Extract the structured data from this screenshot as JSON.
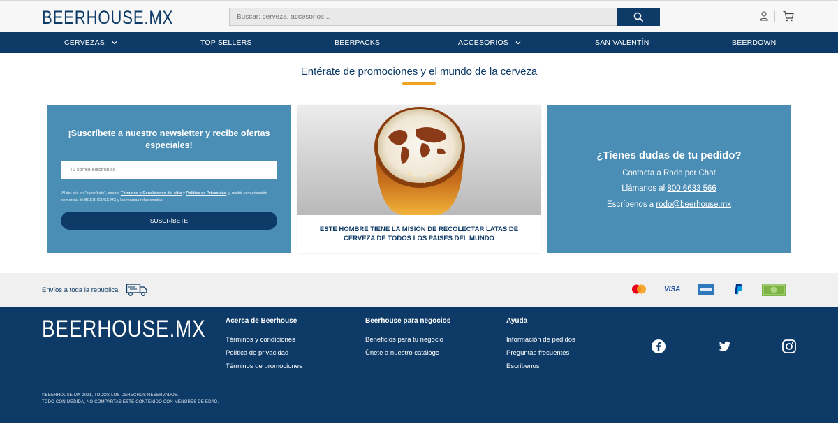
{
  "header": {
    "logo": "BEERHOUSE.MX",
    "search_placeholder": "Buscar: cerveza, accesorios..."
  },
  "nav": {
    "items": [
      {
        "label": "CERVEZAS",
        "has_dropdown": true
      },
      {
        "label": "TOP SELLERS",
        "has_dropdown": false
      },
      {
        "label": "BEERPACKS",
        "has_dropdown": false
      },
      {
        "label": "ACCESORIOS",
        "has_dropdown": true
      },
      {
        "label": "SAN VALENTÍN",
        "has_dropdown": false
      },
      {
        "label": "BEERDOWN",
        "has_dropdown": false
      }
    ]
  },
  "promo": {
    "title": "Entérate de promociones y el mundo de la cerveza"
  },
  "newsletter": {
    "title": "¡Suscríbete a nuestro newsletter y recibe ofertas especiales!",
    "email_placeholder": "Tu correo electrónico",
    "legal_prefix": "Al dar clic en \"suscríbete\", acepto ",
    "legal_terms": "Términos y Condiciones del sitio",
    "legal_mid": " y ",
    "legal_privacy": "Política de Privacidad",
    "legal_suffix": ", y recibir comunicación comercial de BEERHOUSE.MX y las marcas relacionadas.",
    "button": "SUSCRÍBETE"
  },
  "article": {
    "title": "ESTE HOMBRE TIENE LA MISIÓN DE RECOLECTAR LATAS DE CERVEZA DE TODOS LOS PAÍSES DEL MUNDO"
  },
  "help": {
    "title": "¿Tienes dudas de tu pedido?",
    "chat": "Contacta a Rodo por Chat",
    "call_prefix": "Llámanos al ",
    "phone": "800 6633 566",
    "mail_prefix": "Escríbenos a ",
    "email": "rodo@beerhouse.mx"
  },
  "shipping": {
    "text": "Envíos a toda la república"
  },
  "payments": {
    "visa": "VISA"
  },
  "footer": {
    "logo": "BEERHOUSE.MX",
    "col1": {
      "heading": "Acerca de Beerhouse",
      "links": [
        "Términos y condiciones",
        "Política de privacidad",
        "Términos de promociones"
      ]
    },
    "col2": {
      "heading": "Beerhouse para negocios",
      "links": [
        "Beneficios para tu negocio",
        "Únete a nuestro catálogo"
      ]
    },
    "col3": {
      "heading": "Ayuda",
      "links": [
        "Información de pedidos",
        "Preguntas frecuentes",
        "Escríbenos"
      ]
    },
    "copyright_1": "©BEERHOUSE MX 2021, TODOS LOS DERECHOS RESERVADOS.",
    "copyright_2": "TODO CON MEDIDA, NO COMPARTAS ESTE CONTENIDO CON MENORES DE EDAD."
  },
  "colors": {
    "brand_navy": "#0d3a66",
    "card_blue": "#4a8db5",
    "accent_orange": "#f0a321"
  }
}
